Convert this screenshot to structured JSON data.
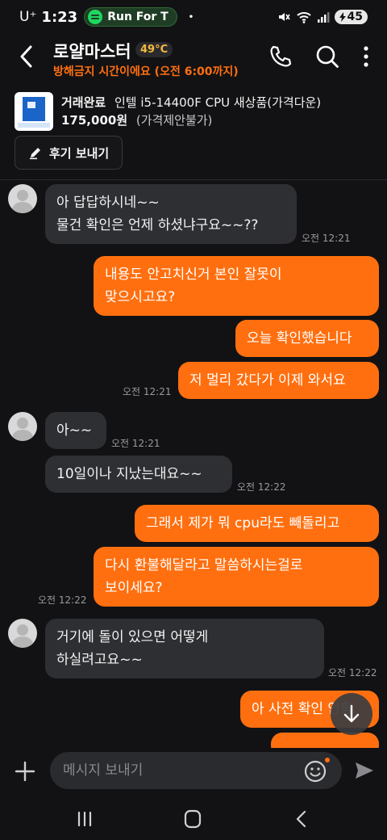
{
  "status_bar": {
    "carrier": "U⁺",
    "time": "1:23",
    "music_pill": "Run For T",
    "dot": "•",
    "battery": "45"
  },
  "header": {
    "title": "로얄마스터",
    "temperature": "49°C",
    "subtitle": "방해금지 시간이에요 (오전 6:00까지)",
    "icons": [
      "back-arrow-icon",
      "phone-icon",
      "search-icon",
      "more-vert-icon"
    ]
  },
  "product": {
    "status": "거래완료",
    "name": "인텔 i5-14400F CPU 새상품(가격다운)",
    "price": "175,000원",
    "price_note": "(가격제안불가)"
  },
  "review_button": {
    "label": "후기 보내기",
    "icon": "pencil-icon"
  },
  "messages": [
    {
      "side": "in",
      "lines": [
        "아 답답하시네~~",
        "물건 확인은 언제 하셨냐구요~~??"
      ],
      "time": "오전 12:21"
    },
    {
      "side": "out",
      "lines": [
        "내용도 안고치신거 본인 잘못이",
        "맞으시고요?"
      ],
      "time": ""
    },
    {
      "side": "out",
      "lines": [
        "오늘 확인했습니다"
      ],
      "time": ""
    },
    {
      "side": "out",
      "lines": [
        "저 멀리 갔다가 이제 와서요"
      ],
      "time": "오전 12:21"
    },
    {
      "side": "in",
      "lines": [
        "아~~"
      ],
      "time": "오전 12:21"
    },
    {
      "side": "in",
      "lines": [
        "10일이나 지났는대요~~"
      ],
      "time": "오전 12:22"
    },
    {
      "side": "out",
      "lines": [
        "그래서 제가 뭐 cpu라도 빼돌리고"
      ],
      "time": ""
    },
    {
      "side": "out",
      "lines": [
        "다시 환불해달라고 말씀하시는걸로",
        "보이세요?"
      ],
      "time": "오전 12:22"
    },
    {
      "side": "in",
      "lines": [
        "거기에 돌이 있으면 어떻게",
        "하실려고요~~"
      ],
      "time": "오전 12:22"
    },
    {
      "side": "out",
      "lines": [
        "아 사전 확인 안함"
      ],
      "time": ""
    }
  ],
  "input": {
    "placeholder": "메시지 보내기"
  },
  "nav_icons": [
    "recent-apps-icon",
    "home-icon",
    "back-icon"
  ]
}
